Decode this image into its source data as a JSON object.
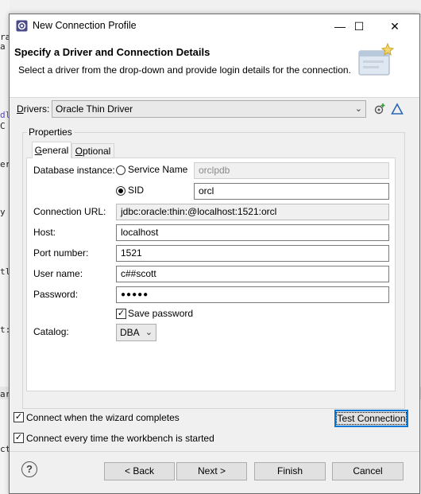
{
  "window": {
    "title": "New Connection Profile",
    "minimize": "—",
    "maximize": "☐",
    "close": "✕"
  },
  "banner": {
    "title": "Specify a Driver and Connection Details",
    "description": "Select a driver from the drop-down and provide login details for the connection."
  },
  "drivers": {
    "label_prefix": "",
    "label_mnemonic": "D",
    "label_rest": "rivers:",
    "selected": "Oracle Thin Driver"
  },
  "properties": {
    "group_label": "Properties",
    "tabs": [
      {
        "mnemonic": "G",
        "rest": "eneral",
        "active": true
      },
      {
        "mnemonic": "O",
        "rest": "ptional",
        "active": false
      }
    ],
    "database_instance_label": "Database instance:",
    "service_name_label": "Service Name",
    "service_name_value": "orclpdb",
    "sid_label": "SID",
    "sid_value": "orcl",
    "connection_url_label": "Connection URL:",
    "connection_url_value": "jdbc:oracle:thin:@localhost:1521:orcl",
    "host_label": "Host:",
    "host_value": "localhost",
    "port_label": "Port number:",
    "port_value": "1521",
    "user_label": "User name:",
    "user_value": "c##scott",
    "password_label": "Password:",
    "password_value": "●●●●●",
    "save_password_label": "Save password",
    "catalog_label": "Catalog:",
    "catalog_value": "DBA"
  },
  "options": {
    "connect_on_finish": "Connect when the wizard completes",
    "connect_on_startup": "Connect every time the workbench is started",
    "test_connection": "Test Connection"
  },
  "buttons": {
    "help": "?",
    "back": "< Back",
    "next": "Next >",
    "finish": "Finish",
    "cancel": "Cancel"
  },
  "background_code": {
    "lines": [
      "ra",
      "a",
      "dl",
      "C",
      "er",
      "y",
      "tl",
      "t:",
      "ar",
      "ct"
    ],
    "right_fragment": ";"
  },
  "colors": {
    "accent": "#0078d7",
    "dialog_bg": "#f0f0f0",
    "banner_bg": "#ffffff"
  }
}
